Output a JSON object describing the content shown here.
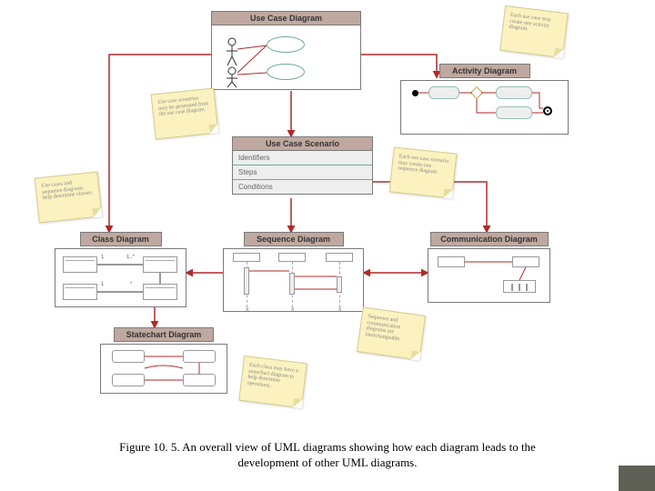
{
  "diagrams": {
    "use_case": {
      "title": "Use Case Diagram"
    },
    "activity": {
      "title": "Activity Diagram"
    },
    "scenario": {
      "title": "Use Case Scenario",
      "rows": [
        "Identifiers",
        "Steps",
        "Conditions"
      ]
    },
    "class": {
      "title": "Class Diagram"
    },
    "sequence": {
      "title": "Sequence Diagram"
    },
    "communication": {
      "title": "Communication Diagram"
    },
    "statechart": {
      "title": "Statechart Diagram"
    },
    "class_mult1": "1..*",
    "class_mult2": "1",
    "class_mult3": "*"
  },
  "notes": {
    "n1": "Each use case may create one activity diagram.",
    "n2": "Use case scenarios may be generated from the use case diagram.",
    "n3": "Use cases and sequence diagrams help determine classes.",
    "n4": "Each use case scenario may create one sequence diagram.",
    "n5": "Sequence and communication diagrams are interchangeable.",
    "n6": "Each class may have a statechart diagram to help determine operations."
  },
  "caption": {
    "line1": "Figure  10. 5.  An overall view of UML diagrams showing how each diagram leads to the",
    "line2": "development of other UML diagrams."
  }
}
